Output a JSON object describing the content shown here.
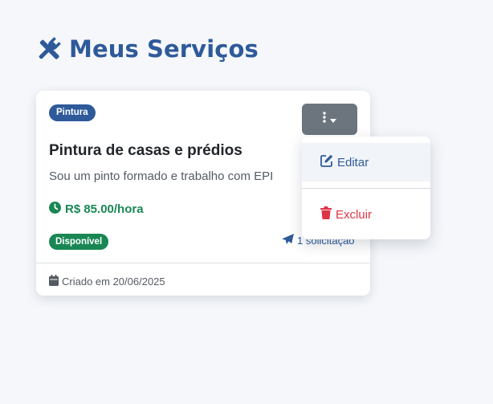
{
  "header": {
    "title": "Meus Serviços",
    "icon": "tools-icon"
  },
  "service_card": {
    "category": "Pintura",
    "title": "Pintura de casas e prédios",
    "description": "Sou um pinto formado e trabalho com EPI",
    "price": "R$ 85.00/hora",
    "status": "Disponível",
    "requests": "1 solicitação",
    "created": "Criado em 20/06/2025"
  },
  "actions_menu": {
    "toggle_icon": "ellipsis-vertical-icon",
    "items": [
      {
        "label": "Editar",
        "icon": "edit-icon"
      },
      {
        "label": "Excluir",
        "icon": "trash-icon"
      }
    ]
  },
  "colors": {
    "primary": "#2e5a9a",
    "success": "#198754",
    "danger": "#dc3545",
    "secondary": "#6c757d",
    "background": "#f5f7fb"
  }
}
